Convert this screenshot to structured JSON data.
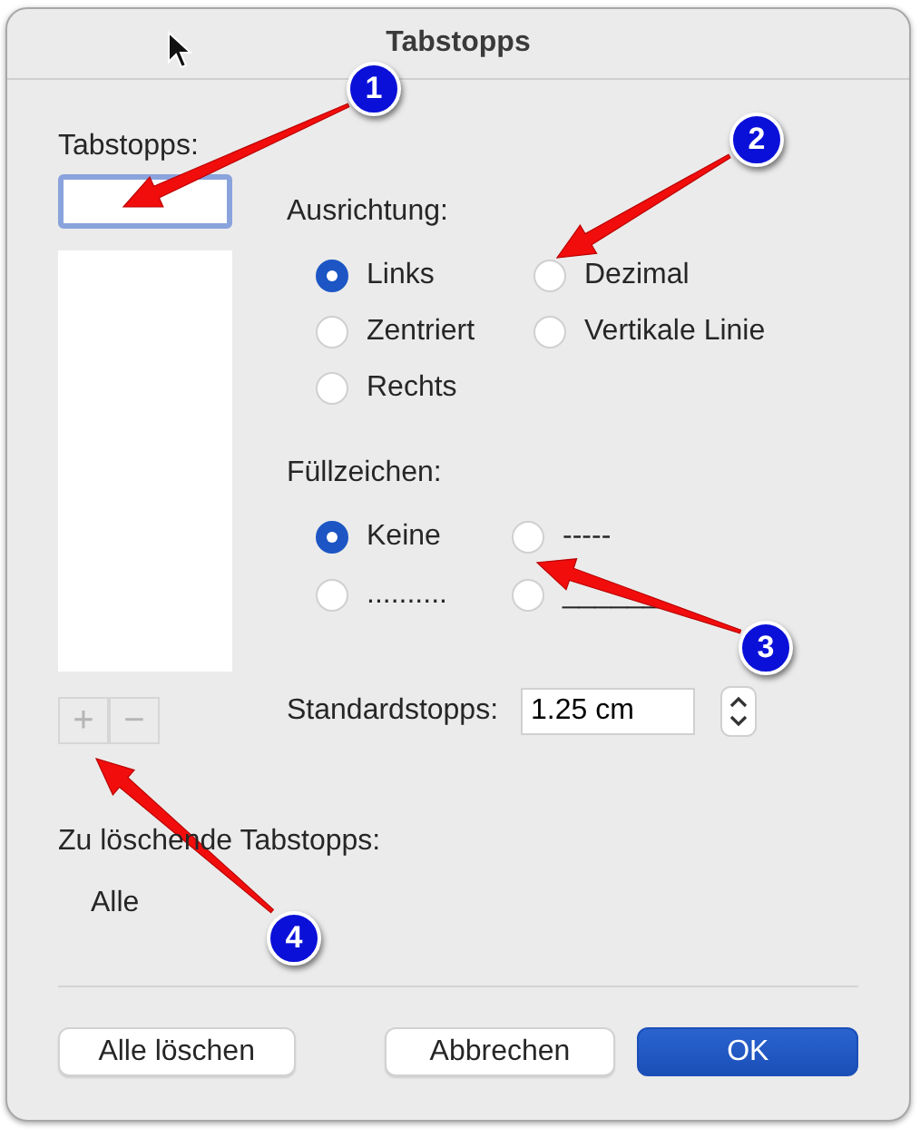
{
  "window": {
    "title": "Tabstopps"
  },
  "tab_stops": {
    "label": "Tabstopps:"
  },
  "list_buttons": [
    {
      "label": "+",
      "disabled": true
    },
    {
      "label": "−",
      "disabled": true
    }
  ],
  "alignment": {
    "label": "Ausrichtung:",
    "options": [
      {
        "label": "Links",
        "selected": true
      },
      {
        "label": "Dezimal",
        "selected": false
      },
      {
        "label": "Zentriert",
        "selected": false
      },
      {
        "label": "Vertikale Linie",
        "selected": false
      },
      {
        "label": "Rechts",
        "selected": false
      }
    ]
  },
  "leader": {
    "label": "Füllzeichen:",
    "options": [
      {
        "label": "Keine",
        "selected": true
      },
      {
        "label": "-----",
        "selected": false
      },
      {
        "label": "..........",
        "selected": false
      },
      {
        "label": "______",
        "selected": false
      }
    ]
  },
  "default_stops": {
    "label": "Standardstopps:",
    "value": "1.25 cm"
  },
  "to_clear": {
    "label": "Zu löschende Tabstopps:",
    "value": "Alle"
  },
  "buttons": [
    {
      "label": "Alle löschen",
      "kind": "normal"
    },
    {
      "label": "Abbrechen",
      "kind": "normal"
    },
    {
      "label": "OK",
      "kind": "default"
    }
  ],
  "callouts": [
    {
      "number": "1"
    },
    {
      "number": "2"
    },
    {
      "number": "3"
    },
    {
      "number": "4"
    }
  ]
}
